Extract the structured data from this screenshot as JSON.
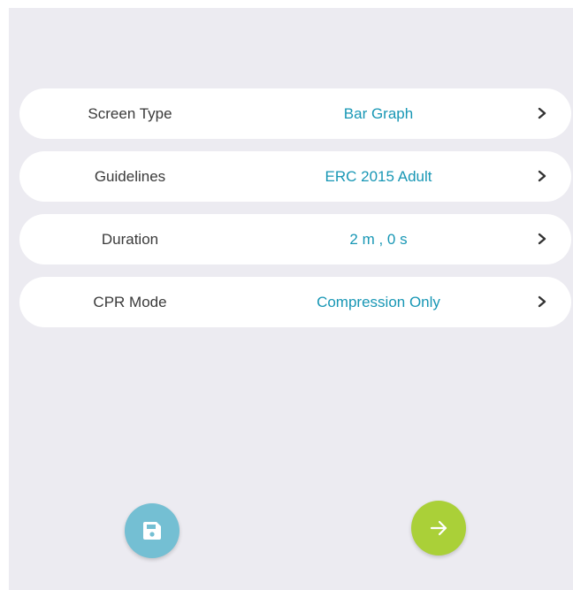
{
  "settings": {
    "rows": [
      {
        "label": "Screen Type",
        "value": "Bar Graph"
      },
      {
        "label": "Guidelines",
        "value": "ERC 2015 Adult"
      },
      {
        "label": "Duration",
        "value": "2 m , 0 s"
      },
      {
        "label": "CPR Mode",
        "value": "Compression Only"
      }
    ]
  },
  "actions": {
    "save_icon": "floppy-disk-icon",
    "next_icon": "arrow-right-icon"
  },
  "colors": {
    "background": "#ecebf1",
    "row_background": "#ffffff",
    "label_text": "#3a3a3a",
    "value_text": "#1897b5",
    "save_button": "#74bfd3",
    "next_button": "#aad038"
  }
}
